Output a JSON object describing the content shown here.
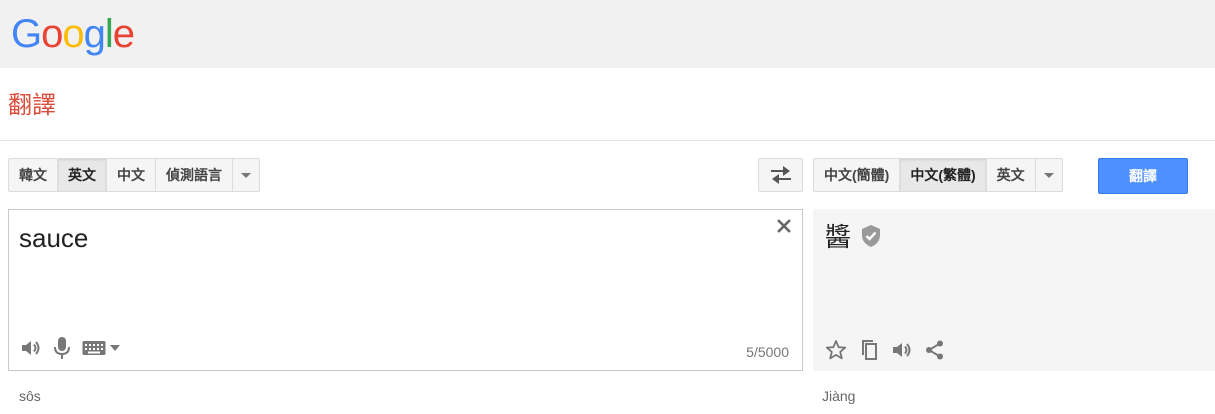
{
  "header": {
    "logo_letters": [
      {
        "ch": "G",
        "color": "#4285f4"
      },
      {
        "ch": "o",
        "color": "#ea4335"
      },
      {
        "ch": "o",
        "color": "#fbbc05"
      },
      {
        "ch": "g",
        "color": "#4285f4"
      },
      {
        "ch": "l",
        "color": "#34a853"
      },
      {
        "ch": "e",
        "color": "#ea4335"
      }
    ],
    "subtitle": "翻譯"
  },
  "source_langs": {
    "items": [
      {
        "label": "韓文",
        "selected": false
      },
      {
        "label": "英文",
        "selected": true
      },
      {
        "label": "中文",
        "selected": false
      },
      {
        "label": "偵測語言",
        "selected": false
      }
    ]
  },
  "target_langs": {
    "items": [
      {
        "label": "中文(簡體)",
        "selected": false
      },
      {
        "label": "中文(繁體)",
        "selected": true
      },
      {
        "label": "英文",
        "selected": false
      }
    ]
  },
  "translate_button": "翻譯",
  "source": {
    "text": "sauce",
    "counter": "5/5000",
    "transliteration": "sôs"
  },
  "target": {
    "text": "醬",
    "transliteration": "Jiàng"
  },
  "colors": {
    "accent": "#4d90fe",
    "subtitle": "#dd4b39"
  }
}
